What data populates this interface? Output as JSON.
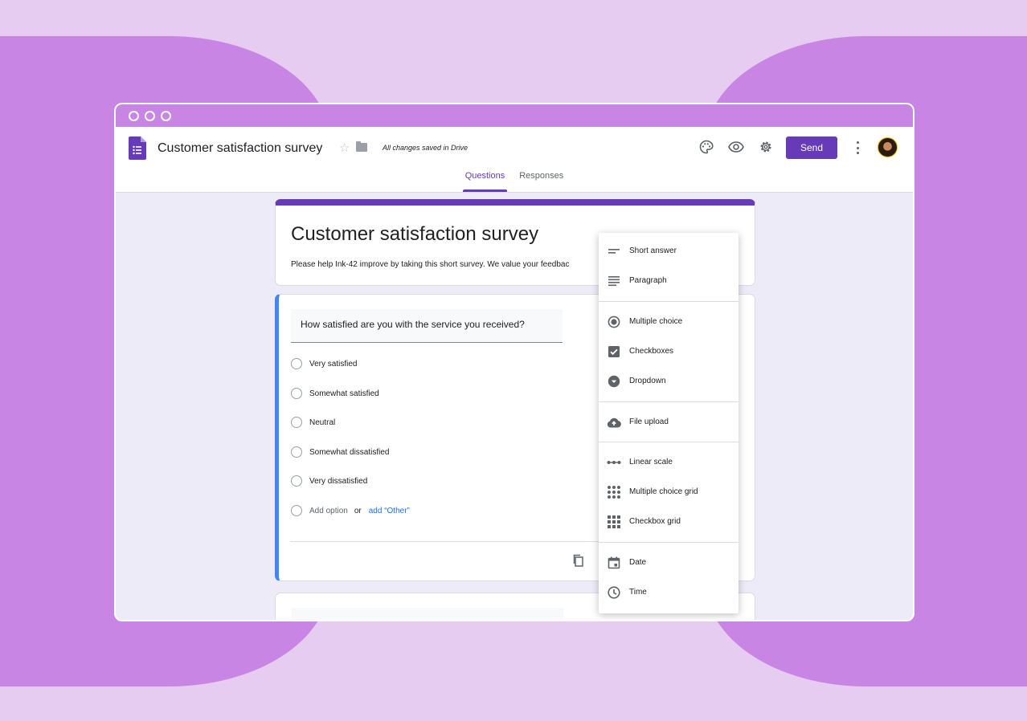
{
  "app": {
    "doc_title": "Customer satisfaction survey",
    "save_status": "All changes saved in Drive",
    "send_label": "Send",
    "icons": [
      "forms-logo-icon",
      "star-icon",
      "folder-icon",
      "palette-icon",
      "eye-icon",
      "gear-icon",
      "more-vert-icon"
    ],
    "accent": "#673ab7"
  },
  "tabs": [
    {
      "label": "Questions",
      "active": true
    },
    {
      "label": "Responses",
      "active": false
    }
  ],
  "form": {
    "title": "Customer satisfaction survey",
    "description": "Please help Ink-42 improve by taking this short survey. We value your feedbac"
  },
  "question": {
    "text": "How satisfied are you with the service you received?",
    "options": [
      "Very satisfied",
      "Somewhat satisfied",
      "Neutral",
      "Somewhat dissatisfied",
      "Very dissatisfied"
    ],
    "add_option": "Add option",
    "or_text": "or",
    "add_other": "add “Other”"
  },
  "type_menu": [
    {
      "label": "Short answer",
      "icon": "short-answer-icon"
    },
    {
      "label": "Paragraph",
      "icon": "paragraph-icon"
    },
    {
      "label": "Multiple choice",
      "icon": "radio-button-icon"
    },
    {
      "label": "Checkboxes",
      "icon": "checkbox-icon"
    },
    {
      "label": "Dropdown",
      "icon": "dropdown-icon"
    },
    {
      "label": "File upload",
      "icon": "cloud-upload-icon"
    },
    {
      "label": "Linear scale",
      "icon": "linear-scale-icon"
    },
    {
      "label": "Multiple choice grid",
      "icon": "dot-grid-icon"
    },
    {
      "label": "Checkbox grid",
      "icon": "checkbox-grid-icon"
    },
    {
      "label": "Date",
      "icon": "calendar-icon"
    },
    {
      "label": "Time",
      "icon": "clock-icon"
    }
  ]
}
